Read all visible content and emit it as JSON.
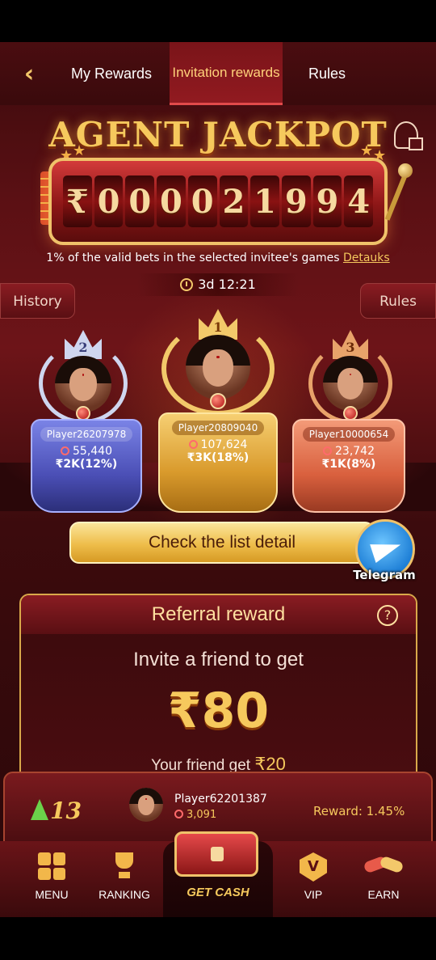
{
  "header": {
    "tabs": [
      {
        "label": "My Rewards"
      },
      {
        "label": "Invitation rewards"
      },
      {
        "label": "Rules"
      }
    ]
  },
  "jackpot": {
    "title": "AGENT JACKPOT",
    "digits": [
      "₹",
      "0",
      "0",
      "0",
      "0",
      "2",
      "1",
      "9",
      "9",
      "4"
    ],
    "desc_pct": "1%",
    "desc_text": " of the valid bets in the selected invitee's games ",
    "desc_link": "Detauks",
    "timer": "3d 12:21"
  },
  "side_buttons": {
    "history": "History",
    "rules": "Rules"
  },
  "podium": [
    {
      "rank": "2",
      "name": "Player26207978",
      "score": "55,440",
      "prize": "₹2K(12%)"
    },
    {
      "rank": "1",
      "name": "Player20809040",
      "score": "107,624",
      "prize": "₹3K(18%)"
    },
    {
      "rank": "3",
      "name": "Player10000654",
      "score": "23,742",
      "prize": "₹1K(8%)"
    }
  ],
  "check_list": {
    "label": "Check the list detail"
  },
  "telegram": {
    "label": "Telegram"
  },
  "referral": {
    "title": "Referral reward",
    "help": "?",
    "invite": "Invite a friend to get",
    "amount": "₹80",
    "friend_prefix": "Your friend get ",
    "friend_amount": "₹20"
  },
  "me": {
    "rank_up": "13",
    "name": "Player62201387",
    "score": "3,091",
    "reward": "Reward: 1.45%"
  },
  "nav": {
    "menu": "MENU",
    "ranking": "RANKING",
    "get_cash": "GET CASH",
    "vip": "VIP",
    "earn": "EARN"
  },
  "colors": {
    "accent_gold": "#f6c95d",
    "background": "#5b1014",
    "tab_active": "#911a20"
  }
}
